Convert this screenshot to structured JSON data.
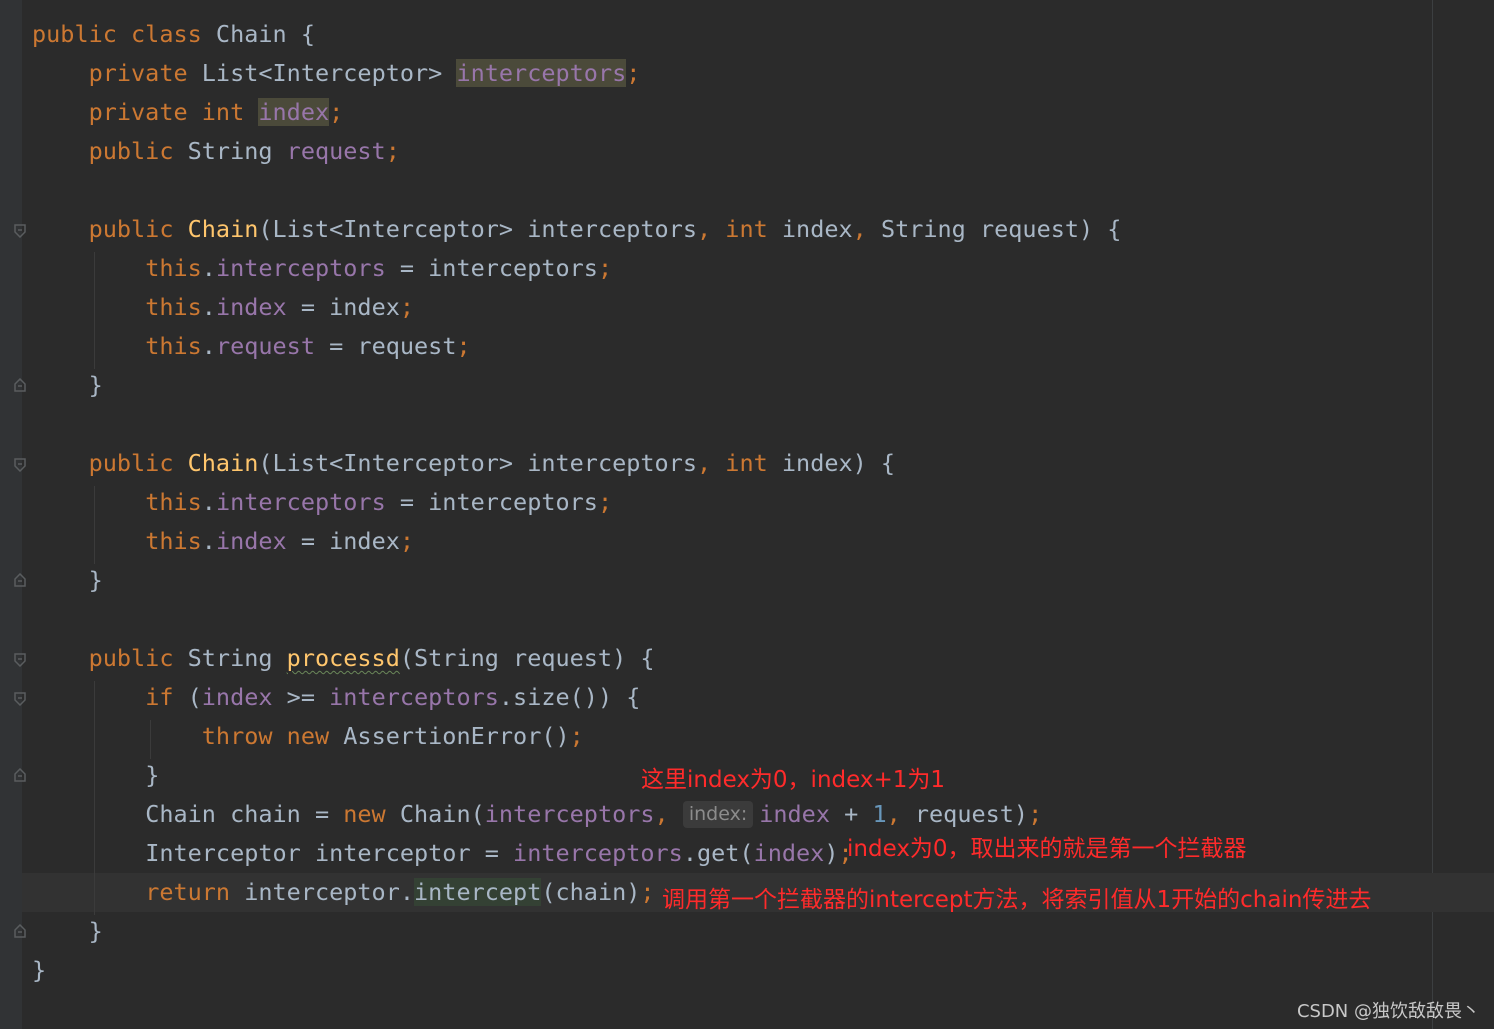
{
  "editor": {
    "language": "java",
    "theme_colors": {
      "background": "#2b2b2b",
      "keyword": "#cc7832",
      "field": "#9876aa",
      "method_declaration": "#ffc66d",
      "number": "#6897bb",
      "default_text": "#a9b7c6",
      "annotation_text": "#ff2b2b"
    },
    "code": {
      "l1": {
        "a": "public class",
        "b": " Chain {"
      },
      "l2": {
        "a": "private",
        "b": " List<Interceptor> ",
        "c": "interceptors",
        "d": ";"
      },
      "l3": {
        "a": "private int",
        "b": " ",
        "c": "index",
        "d": ";"
      },
      "l4": {
        "a": "public",
        "b": " String ",
        "c": "request",
        "d": ";"
      },
      "l6": {
        "a": "public",
        "b": " ",
        "c": "Chain",
        "d": "(List<Interceptor> interceptors",
        "e": ", ",
        "f": "int",
        "g": " index",
        "h": ", ",
        "i": "String request) {"
      },
      "l7": {
        "a": "this",
        "b": ".",
        "c": "interceptors",
        "d": " = interceptors",
        "e": ";"
      },
      "l8": {
        "a": "this",
        "b": ".",
        "c": "index",
        "d": " = index",
        "e": ";"
      },
      "l9": {
        "a": "this",
        "b": ".",
        "c": "request",
        "d": " = request",
        "e": ";"
      },
      "l10": {
        "a": "}"
      },
      "l12": {
        "a": "public",
        "b": " ",
        "c": "Chain",
        "d": "(List<Interceptor> interceptors",
        "e": ", ",
        "f": "int",
        "g": " index) {"
      },
      "l13": {
        "a": "this",
        "b": ".",
        "c": "interceptors",
        "d": " = interceptors",
        "e": ";"
      },
      "l14": {
        "a": "this",
        "b": ".",
        "c": "index",
        "d": " = index",
        "e": ";"
      },
      "l15": {
        "a": "}"
      },
      "l17": {
        "a": "public",
        "b": " String ",
        "c": "processd",
        "d": "(String request) {"
      },
      "l18": {
        "a": "if",
        "b": " (",
        "c": "index",
        "d": " >= ",
        "e": "interceptors",
        "f": ".size()) {"
      },
      "l19": {
        "a": "throw new",
        "b": " AssertionError()",
        "c": ";"
      },
      "l20": {
        "a": "}"
      },
      "l21": {
        "a": "Chain chain = ",
        "b": "new",
        "c": " Chain(",
        "d": "interceptors",
        "e": ", ",
        "hint": "index:",
        "f": "index",
        "g": " + ",
        "h": "1",
        "i": ", ",
        "j": "request)",
        "k": ";"
      },
      "l22": {
        "a": "Interceptor interceptor = ",
        "b": "interceptors",
        "c": ".get(",
        "d": "index",
        "e": ")",
        "f": ";"
      },
      "l23": {
        "a": "return",
        "b": " interceptor.",
        "c": "intercept",
        "d": "(chain)",
        "e": ";"
      },
      "l24": {
        "a": "}"
      },
      "l25": {
        "a": "}"
      }
    }
  },
  "annotations": {
    "a1": "这里index为0，index+1为1",
    "a2": "index为0，取出来的就是第一个拦截器",
    "a3": "调用第一个拦截器的intercept方法，将索引值从1开始的chain传进去"
  },
  "watermark": "CSDN @独饮敌敌畏丶"
}
